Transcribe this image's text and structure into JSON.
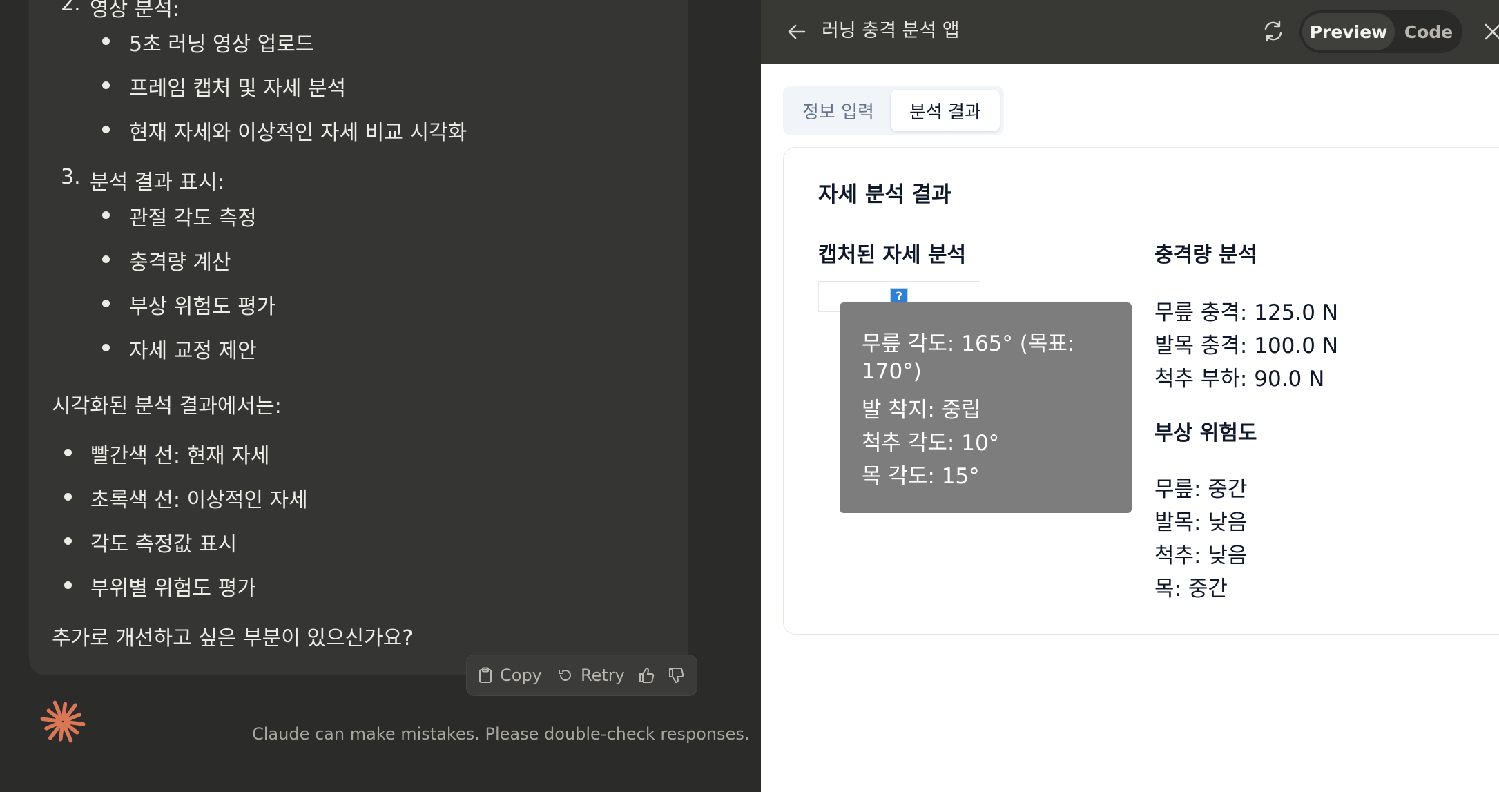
{
  "chat": {
    "list2": {
      "num": "2.",
      "label": "영상 분석:",
      "items": [
        "5초 러닝 영상 업로드",
        "프레임 캡처 및 자세 분석",
        "현재 자세와 이상적인 자세 비교 시각화"
      ]
    },
    "list3": {
      "num": "3.",
      "label": "분석 결과 표시:",
      "items": [
        "관절 각도 측정",
        "충격량 계산",
        "부상 위험도 평가",
        "자세 교정 제안"
      ]
    },
    "viz_intro": "시각화된 분석 결과에서는:",
    "viz_items": [
      "빨간색 선: 현재 자세",
      "초록색 선: 이상적인 자세",
      "각도 측정값 표시",
      "부위별 위험도 평가"
    ],
    "question": "추가로 개선하고 싶은 부분이 있으신가요?",
    "actions": {
      "copy": "Copy",
      "retry": "Retry"
    },
    "disclaimer": "Claude can make mistakes. Please double-check responses.",
    "brand_color": "#d97757"
  },
  "panel": {
    "title": "러닝 충격 분석 앱",
    "toggle": {
      "preview": "Preview",
      "code": "Code"
    },
    "tabs": [
      "정보 입력",
      "분석 결과"
    ],
    "active_tab": "분석 결과",
    "card": {
      "title": "자세 분석 결과",
      "captured_title": "캡처된 자세 분석",
      "broken_image_glyph": "?",
      "overlay_lines": [
        "무릎 각도: 165° (목표:",
        "170°)",
        "발 착지: 중립",
        "척추 각도: 10°",
        "목 각도: 15°"
      ],
      "impact_title": "충격량 분석",
      "impact_lines": [
        "무릎 충격: 125.0 N",
        "발목 충격: 100.0 N",
        "척추 부하: 90.0 N"
      ],
      "risk_title": "부상 위험도",
      "risk_lines": [
        "무릎: 중간",
        "발목: 낮음",
        "척추: 낮음",
        "목: 중간"
      ]
    }
  }
}
